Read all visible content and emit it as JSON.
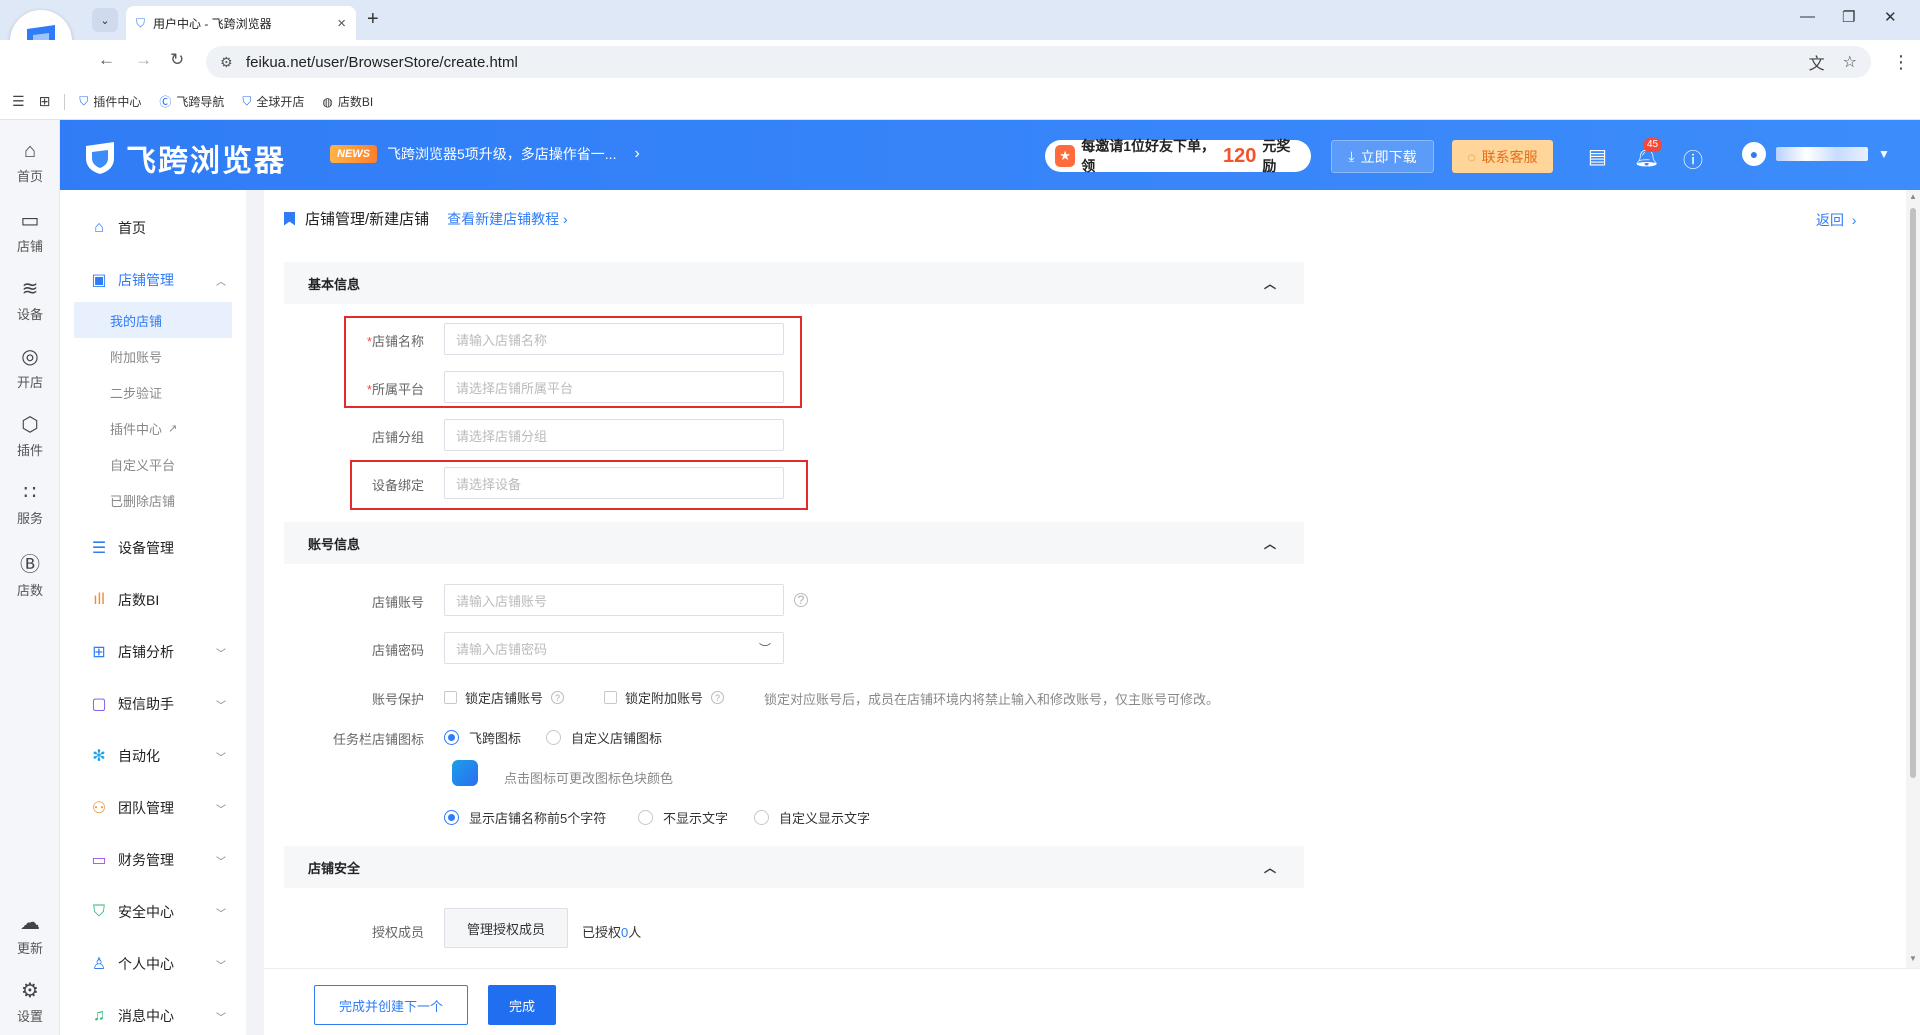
{
  "browser": {
    "tab_title": "用户中心 - 飞跨浏览器",
    "url": "feikua.net/user/BrowserStore/create.html",
    "bookmarks": [
      "插件中心",
      "飞跨导航",
      "全球开店",
      "店数BI"
    ]
  },
  "header": {
    "logo_text": "飞跨浏览器",
    "news_badge": "NEWS",
    "news_text": "飞跨浏览器5项升级，多店操作省一...",
    "invite_prefix": "每邀请1位好友下单，领",
    "invite_amount": "120",
    "invite_suffix": "元奖励",
    "download_label": "立即下载",
    "service_label": "联系客服",
    "notification_count": "45"
  },
  "rail": [
    "首页",
    "店铺",
    "设备",
    "开店",
    "插件",
    "服务",
    "店数",
    "更新",
    "设置"
  ],
  "sidebar": {
    "home": "首页",
    "store_mgmt": "店铺管理",
    "store_sub": [
      "我的店铺",
      "附加账号",
      "二步验证",
      "插件中心",
      "自定义平台",
      "已删除店铺"
    ],
    "device_mgmt": "设备管理",
    "store_bi": "店数BI",
    "store_analysis": "店铺分析",
    "sms": "短信助手",
    "automation": "自动化",
    "team": "团队管理",
    "finance": "财务管理",
    "security": "安全中心",
    "personal": "个人中心",
    "messages": "消息中心"
  },
  "main": {
    "breadcrumb": "店铺管理/新建店铺",
    "tutorial_link": "查看新建店铺教程",
    "back": "返回",
    "sections": {
      "basic": "基本信息",
      "account": "账号信息",
      "security": "店铺安全"
    },
    "fields": {
      "store_name_label": "店铺名称",
      "store_name_placeholder": "请输入店铺名称",
      "platform_label": "所属平台",
      "platform_placeholder": "请选择店铺所属平台",
      "group_label": "店铺分组",
      "group_placeholder": "请选择店铺分组",
      "device_label": "设备绑定",
      "device_placeholder": "请选择设备",
      "account_label": "店铺账号",
      "account_placeholder": "请输入店铺账号",
      "password_label": "店铺密码",
      "password_placeholder": "请输入店铺密码",
      "protect_label": "账号保护",
      "lock_account": "锁定店铺账号",
      "lock_extra": "锁定附加账号",
      "protect_note": "锁定对应账号后，成员在店铺环境内将禁止输入和修改账号，仅主账号可修改。",
      "taskbar_label": "任务栏店铺图标",
      "icon_feikua": "飞跨图标",
      "icon_custom": "自定义店铺图标",
      "icon_hint": "点击图标可更改图标色块颜色",
      "text_first5": "显示店铺名称前5个字符",
      "text_none": "不显示文字",
      "text_custom": "自定义显示文字",
      "auth_label": "授权成员",
      "auth_button": "管理授权成员",
      "auth_prefix": "已授权",
      "auth_count": "0",
      "auth_suffix": "人"
    },
    "footer": {
      "save_next": "完成并创建下一个",
      "done": "完成"
    }
  }
}
